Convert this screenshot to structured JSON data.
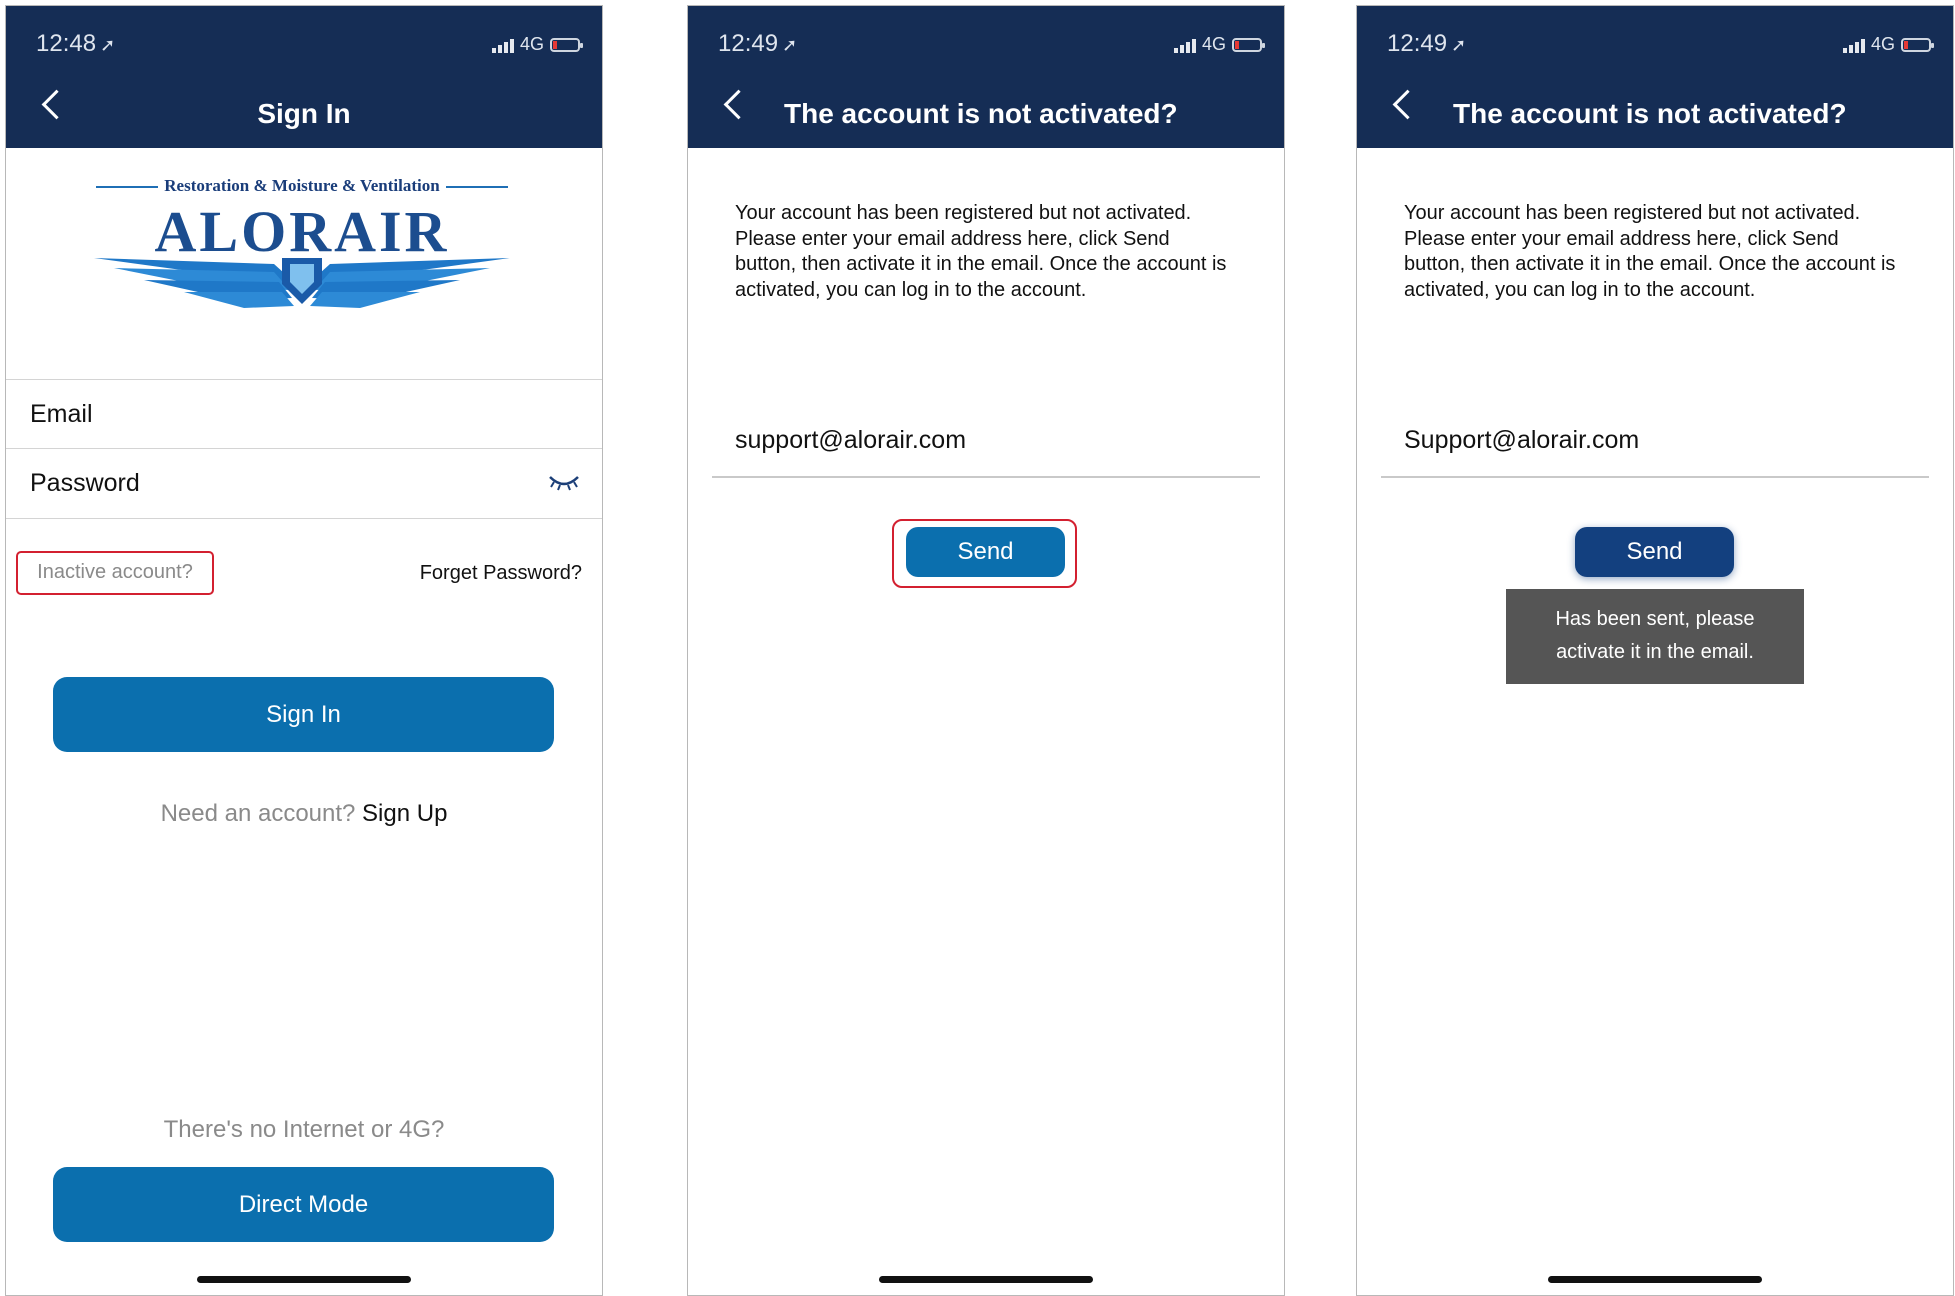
{
  "screen1": {
    "status": {
      "time": "12:48",
      "network": "4G"
    },
    "nav": {
      "title": "Sign In"
    },
    "logo": {
      "tagline": "Restoration & Moisture & Ventilation",
      "wordmark": "ALORAIR"
    },
    "form": {
      "email_label": "Email",
      "password_label": "Password"
    },
    "links": {
      "inactive": "Inactive account?",
      "forget": "Forget Password?"
    },
    "signin_button": "Sign In",
    "signup": {
      "prompt": "Need an account?",
      "link": "Sign Up"
    },
    "offline_prompt": "There's no Internet or 4G?",
    "direct_mode_button": "Direct Mode"
  },
  "screen2": {
    "status": {
      "time": "12:49",
      "network": "4G"
    },
    "nav": {
      "title": "The account is not activated?"
    },
    "description": "Your account has been registered but not activated. Please enter your email address here, click Send button, then activate it in the email. Once the account is activated, you can log in to the account.",
    "email_value": "support@alorair.com",
    "send_button": "Send"
  },
  "screen3": {
    "status": {
      "time": "12:49",
      "network": "4G"
    },
    "nav": {
      "title": "The account is not activated?"
    },
    "description": "Your account has been registered but not activated. Please enter your email address here, click Send button, then activate it in the email. Once the account is activated, you can log in to the account.",
    "email_value": "Support@alorair.com",
    "send_button": "Send",
    "toast": {
      "line1": "Has been sent, please",
      "line2": "activate it in the email."
    }
  },
  "colors": {
    "header": "#152d55",
    "primary_button": "#0b6fae",
    "pressed_button": "#13407f",
    "highlight_border": "#d32030",
    "toast_bg": "#555555",
    "battery_low": "#e53935"
  },
  "icons": [
    "back-chevron-icon",
    "location-arrow-icon",
    "signal-icon",
    "battery-icon",
    "eye-closed-icon"
  ]
}
